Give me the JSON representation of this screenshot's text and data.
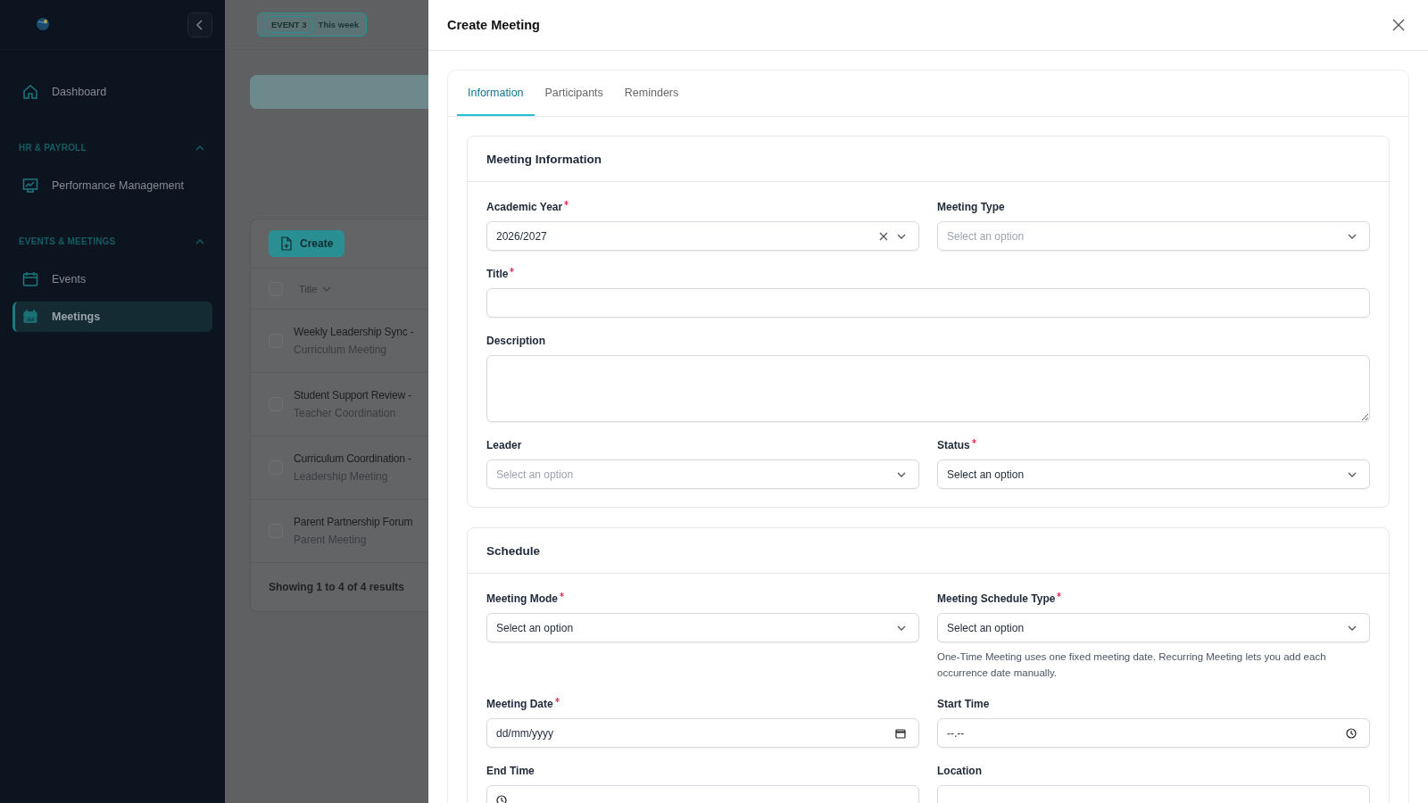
{
  "sidebar": {
    "groups": [
      {
        "items": [
          {
            "label": "Dashboard",
            "selected": false
          }
        ]
      },
      {
        "heading": "HR & PAYROLL",
        "expanded": true,
        "items": [
          {
            "label": "Performance Management",
            "selected": false
          }
        ]
      },
      {
        "heading": "EVENTS & MEETINGS",
        "expanded": true,
        "items": [
          {
            "label": "Events",
            "selected": false
          },
          {
            "label": "Meetings",
            "selected": true
          }
        ]
      }
    ]
  },
  "topbar": {
    "badge": {
      "tag": "EVENT 3",
      "label": "This week"
    }
  },
  "table": {
    "create_button": "Create",
    "column": "Title",
    "all_checked": false,
    "rows": [
      {
        "title": "Weekly Leadership Sync -",
        "subtitle": "Curriculum Meeting",
        "checked": false
      },
      {
        "title": "Student Support Review -",
        "subtitle": "Teacher Coordination",
        "checked": false
      },
      {
        "title": "Curriculum Coordination -",
        "subtitle": "Leadership Meeting",
        "checked": false
      },
      {
        "title": "Parent Partnership Forum",
        "subtitle": "Parent Meeting",
        "checked": false
      }
    ],
    "footer": "Showing 1 to 4 of 4 results"
  },
  "drawer": {
    "title": "Create Meeting",
    "tabs": [
      {
        "label": "Information",
        "selected": true
      },
      {
        "label": "Participants",
        "selected": false
      },
      {
        "label": "Reminders",
        "selected": false
      }
    ],
    "sections": [
      {
        "title": "Meeting Information",
        "fields": [
          {
            "label": "Academic Year",
            "required": true,
            "kind": "select",
            "value": "2026/2027",
            "clearable": true
          },
          {
            "label": "Meeting Type",
            "required": false,
            "kind": "select",
            "placeholder": "Select an option"
          },
          {
            "label": "Title",
            "required": true,
            "kind": "text",
            "full": true
          },
          {
            "label": "Description",
            "required": false,
            "kind": "textarea",
            "full": true
          },
          {
            "label": "Leader",
            "required": false,
            "kind": "select",
            "placeholder": "Select an option"
          },
          {
            "label": "Status",
            "required": true,
            "kind": "select",
            "value": "Select an option"
          }
        ]
      },
      {
        "title": "Schedule",
        "fields": [
          {
            "label": "Meeting Mode",
            "required": true,
            "kind": "select",
            "value": "Select an option"
          },
          {
            "label": "Meeting Schedule Type",
            "required": true,
            "kind": "select",
            "value": "Select an option",
            "help": "One-Time Meeting uses one fixed meeting date. Recurring Meeting lets you add each occurrence date manually."
          },
          {
            "label": "Meeting Date",
            "required": true,
            "kind": "date",
            "value": "dd/mm/yyyy"
          },
          {
            "label": "Start Time",
            "required": false,
            "kind": "time",
            "value": "--.--"
          },
          {
            "label": "End Time",
            "required": false,
            "kind": "time"
          },
          {
            "label": "Location",
            "required": false,
            "kind": "text"
          }
        ]
      }
    ]
  }
}
